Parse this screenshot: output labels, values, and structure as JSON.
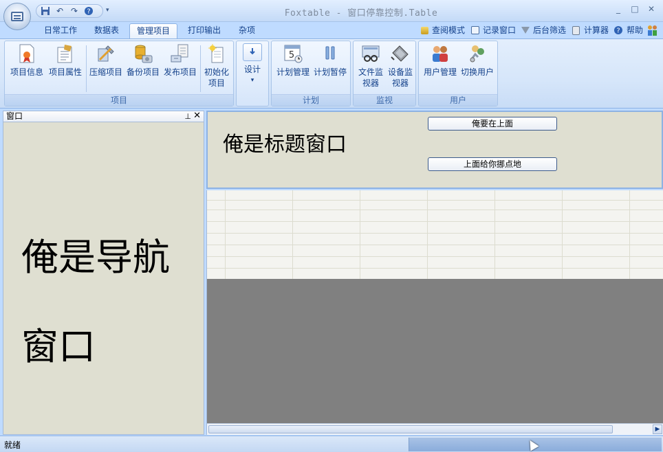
{
  "window": {
    "title": "Foxtable - 窗口停靠控制.Table",
    "controls": {
      "minimize": "_",
      "maximize": "□",
      "close": "✕"
    }
  },
  "qat": {
    "more": "▾"
  },
  "tabs": [
    "日常工作",
    "数据表",
    "管理项目",
    "打印输出",
    "杂项"
  ],
  "active_tab": "管理项目",
  "right_commands": [
    "查阅模式",
    "记录窗口",
    "后台筛选",
    "计算器",
    "帮助"
  ],
  "ribbon": {
    "groups": [
      {
        "label": "项目",
        "buttons": [
          "项目信息",
          "项目属性",
          "压缩项目",
          "备份项目",
          "发布项目",
          "初始化项目"
        ]
      },
      {
        "label": "",
        "buttons": [
          "设计"
        ]
      },
      {
        "label": "计划",
        "buttons": [
          "计划管理",
          "计划暂停"
        ]
      },
      {
        "label": "监视",
        "buttons": [
          "文件监视器",
          "设备监视器"
        ]
      },
      {
        "label": "用户",
        "buttons": [
          "用户管理",
          "切换用户"
        ]
      }
    ]
  },
  "nav_panel": {
    "header": "窗口",
    "pin": "📌",
    "close": "✕",
    "text": "俺是导航窗口"
  },
  "title_panel": {
    "text": "俺是标题窗口",
    "button1": "俺要在上面",
    "button2": "上面给你挪点地"
  },
  "status": {
    "text": "就绪"
  },
  "colors": {
    "ribbon_bg": "#d6e6fa",
    "panel_bg": "#dfdfd1",
    "empty_area": "#808080",
    "accent": "#15428b"
  }
}
